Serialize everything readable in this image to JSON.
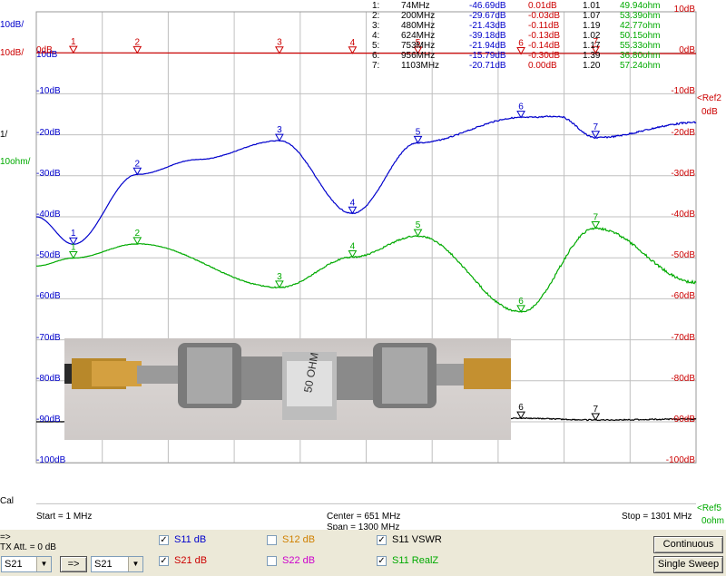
{
  "scale_labels": {
    "s21_scale": "10dB/",
    "s11_scale": "10dB/",
    "s11_ref_label": "10dB",
    "vswr_scale": "1/",
    "realz_scale": "10ohm/",
    "cal": "Cal"
  },
  "left_axis": [
    "0dB",
    "-10dB",
    "-20dB",
    "-30dB",
    "-40dB",
    "-50dB",
    "-60dB",
    "-70dB",
    "-80dB",
    "-90dB",
    "-100dB"
  ],
  "right_axis": [
    "10dB",
    "0dB",
    "-10dB",
    "-20dB",
    "-30dB",
    "-40dB",
    "-50dB",
    "-60dB",
    "-70dB",
    "-80dB",
    "-90dB",
    "-100dB"
  ],
  "ref_labels": {
    "ref_top": "<Ref",
    "ref_top_val": "0dB",
    "ref_bottom": "<Ref",
    "ref_bottom_val": "0ohm",
    "ref_num": "2",
    "ref_num_b": "5"
  },
  "markers": [
    {
      "n": "1:",
      "freq": "74MHz",
      "s11": "-46.69dB",
      "s21": "0.01dB",
      "vswr": "1.01",
      "z": "49.94ohm"
    },
    {
      "n": "2:",
      "freq": "200MHz",
      "s11": "-29.67dB",
      "s21": "-0.03dB",
      "vswr": "1.07",
      "z": "53.39ohm"
    },
    {
      "n": "3:",
      "freq": "480MHz",
      "s11": "-21.43dB",
      "s21": "-0.11dB",
      "vswr": "1.19",
      "z": "42.77ohm"
    },
    {
      "n": "4:",
      "freq": "624MHz",
      "s11": "-39.18dB",
      "s21": "-0.13dB",
      "vswr": "1.02",
      "z": "50.15ohm"
    },
    {
      "n": "5:",
      "freq": "753MHz",
      "s11": "-21.94dB",
      "s21": "-0.14dB",
      "vswr": "1.17",
      "z": "55.33ohm"
    },
    {
      "n": "6:",
      "freq": "956MHz",
      "s11": "-15.79dB",
      "s21": "-0.30dB",
      "vswr": "1.39",
      "z": "36.80ohm"
    },
    {
      "n": "7:",
      "freq": "1103MHz",
      "s11": "-20.71dB",
      "s21": "0.00dB",
      "vswr": "1.20",
      "z": "57.24ohm"
    }
  ],
  "sweep": {
    "start": "Start = 1 MHz",
    "center": "Center = 651 MHz",
    "span": "Span = 1300 MHz",
    "stop": "Stop = 1301 MHz"
  },
  "controls": {
    "arrow_label": "=>",
    "tx_att": "TX Att.  = 0 dB",
    "select_left": "S21",
    "select_right": "S21",
    "arrow_button": "=>",
    "s11db": "S11  dB",
    "s21db": "S21  dB",
    "s12db": "S12  dB",
    "s22db": "S22  dB",
    "s11vswr": "S11  VSWR",
    "s11realz": "S11  RealZ",
    "continuous": "Continuous",
    "single_sweep": "Single Sweep"
  },
  "photo_label": "50 OHM",
  "colors": {
    "s21": "#cc0000",
    "s11": "#0000cc",
    "vswr": "#000000",
    "realz": "#00aa00",
    "grid": "#c0c0c0",
    "s12": "#d08000",
    "s22": "#cc00cc"
  },
  "chart_data": {
    "type": "line",
    "x_range_mhz": [
      1,
      1301
    ],
    "y_range_db": [
      -100,
      10
    ],
    "marker_freqs_mhz": [
      74,
      200,
      480,
      624,
      753,
      956,
      1103
    ],
    "series": [
      {
        "name": "S21 dB",
        "values_db": [
          0.01,
          -0.03,
          -0.11,
          -0.13,
          -0.14,
          -0.3,
          0.0
        ]
      },
      {
        "name": "S11 dB",
        "values_db": [
          -46.69,
          -29.67,
          -21.43,
          -39.18,
          -21.94,
          -15.79,
          -20.71
        ]
      },
      {
        "name": "S11 VSWR",
        "values": [
          1.01,
          1.07,
          1.19,
          1.02,
          1.17,
          1.39,
          1.2
        ]
      },
      {
        "name": "S11 RealZ",
        "values_ohm": [
          49.94,
          53.39,
          42.77,
          50.15,
          55.33,
          36.8,
          57.24
        ]
      }
    ]
  }
}
